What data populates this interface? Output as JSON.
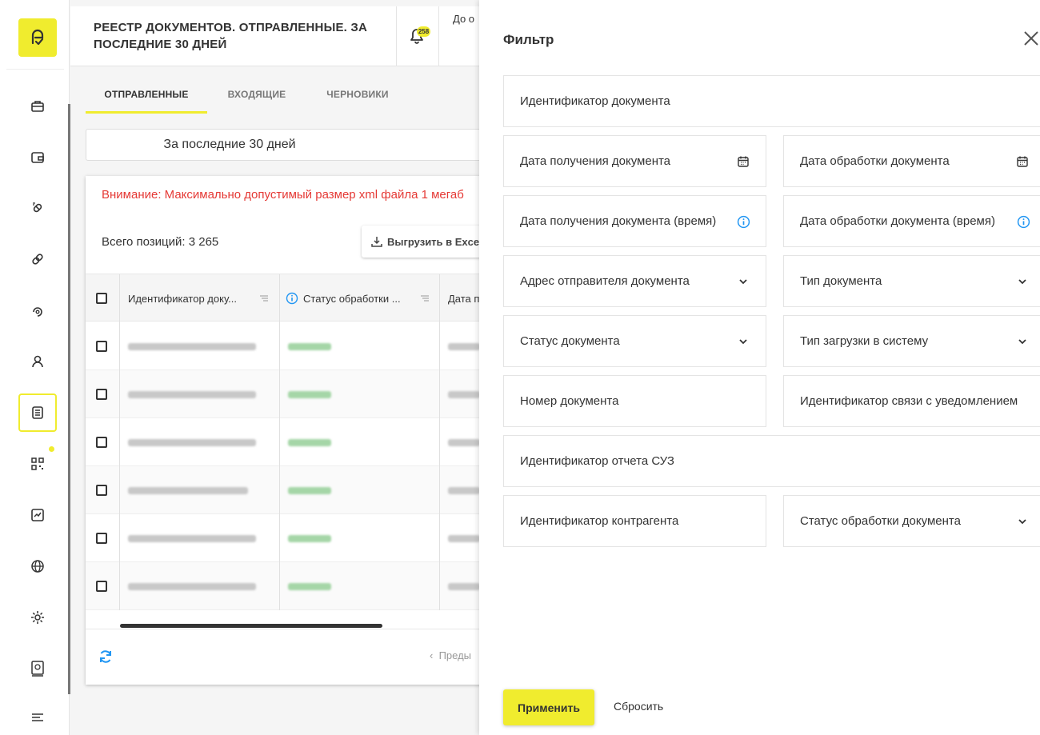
{
  "colors": {
    "accent": "#f0ec2e",
    "warning": "#e53935",
    "info": "#2196f3",
    "status_blurred": "#a5d6a7"
  },
  "header": {
    "title": "РЕЕСТР ДОКУМЕНТОВ. ОТПРАВЛЕННЫЕ. ЗА ПОСЛЕДНИЕ 30 ДНЕЙ",
    "notification_count": "258",
    "truncated_text": "До о"
  },
  "sidebar": {
    "logo_icon": "logo-icon",
    "items": [
      {
        "icon": "briefcase-icon",
        "active": false
      },
      {
        "icon": "wallet-icon",
        "active": false
      },
      {
        "icon": "pills-icon",
        "active": false
      },
      {
        "icon": "link-icon",
        "active": false
      },
      {
        "icon": "refresh-dot-icon",
        "active": false
      },
      {
        "icon": "user-icon",
        "active": false
      },
      {
        "icon": "document-list-icon",
        "active": true
      },
      {
        "icon": "qr-code-icon",
        "active": false
      },
      {
        "icon": "chart-icon",
        "active": false
      },
      {
        "icon": "globe-icon",
        "active": false
      },
      {
        "icon": "gear-icon",
        "active": false
      },
      {
        "icon": "book-icon",
        "active": false
      },
      {
        "icon": "menu-icon",
        "active": false
      }
    ]
  },
  "tabs": [
    {
      "label": "ОТПРАВЛЕННЫЕ",
      "active": true
    },
    {
      "label": "ВХОДЯЩИЕ",
      "active": false
    },
    {
      "label": "ЧЕРНОВИКИ",
      "active": false
    }
  ],
  "period": {
    "label": "За последние 30 дней"
  },
  "registry": {
    "warning": "Внимание: Максимально допустимый размер xml файла 1 мегаб",
    "total": "Всего позиций: 3 265",
    "export_label": "Выгрузить в Exce",
    "columns": [
      "Идентификатор доку...",
      "Статус обработки ...",
      "Дата п"
    ],
    "rows_count_visible": 6,
    "pager_prev": "Преды"
  },
  "filter": {
    "title": "Фильтр",
    "fields": {
      "doc_id": "Идентификатор документа",
      "received_date": "Дата получения документа",
      "processed_date": "Дата обработки документа",
      "received_time": "Дата получения документа (время)",
      "processed_time": "Дата обработки документа (время)",
      "sender_address": "Адрес отправителя документа",
      "doc_type": "Тип документа",
      "doc_status": "Статус документа",
      "upload_type": "Тип загрузки в систему",
      "doc_number": "Номер документа",
      "notification_link_id": "Идентификатор связи с уведомлением",
      "suz_report_id": "Идентификатор отчета СУЗ",
      "counterparty_id": "Идентификатор контрагента",
      "processing_status": "Статус обработки документа"
    },
    "apply_label": "Применить",
    "reset_label": "Сбросить"
  }
}
